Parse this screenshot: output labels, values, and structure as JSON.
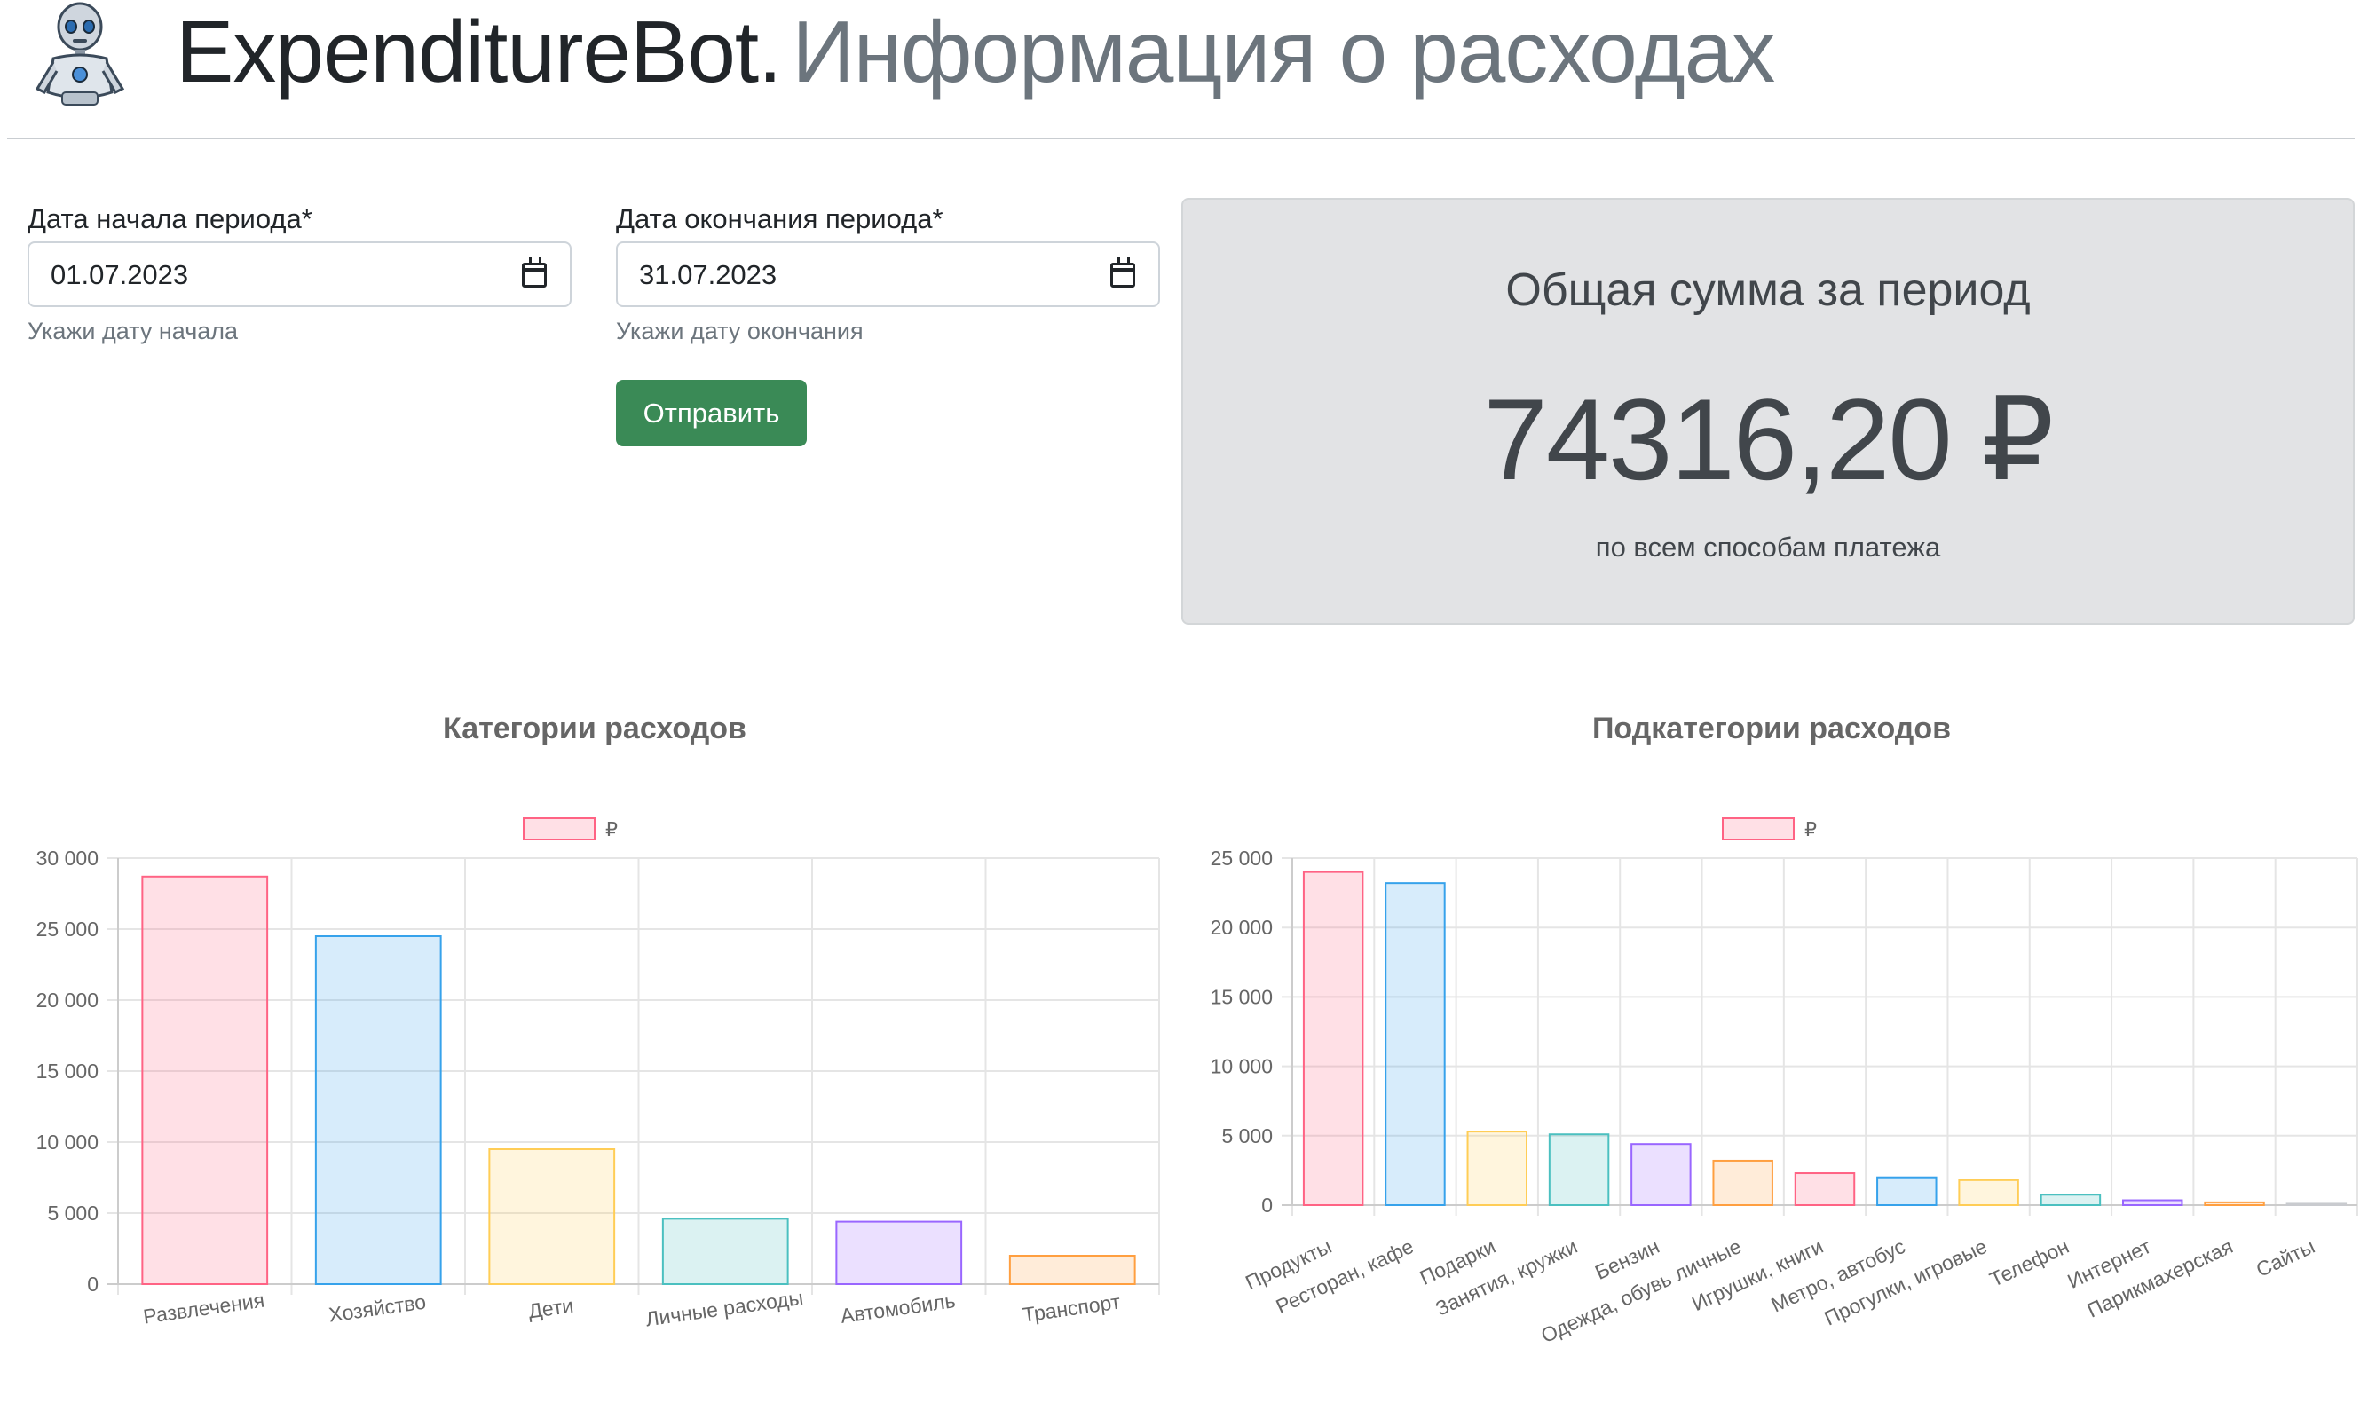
{
  "header": {
    "app_name": "ExpenditureBot.",
    "subtitle": "Информация о расходах",
    "logo_icon": "robot-icon"
  },
  "form": {
    "start": {
      "label": "Дата начала периода*",
      "value": "01.07.2023",
      "help": "Укажи дату начала",
      "icon": "calendar-icon"
    },
    "end": {
      "label": "Дата окончания периода*",
      "value": "31.07.2023",
      "help": "Укажи дату окончания",
      "icon": "calendar-icon"
    },
    "submit_label": "Отправить",
    "submit_color": "#3a8a56"
  },
  "summary": {
    "title": "Общая сумма за период",
    "amount": "74316,20 ₽",
    "note": "по всем способам платежа",
    "background": "#e2e3e5"
  },
  "chart_data": [
    {
      "type": "bar",
      "title": "Категории расходов",
      "legend": [
        "₽"
      ],
      "legend_position": "top",
      "grid": true,
      "ylim": [
        0,
        30000
      ],
      "yticks": [
        "0",
        "5 000",
        "10 000",
        "15 000",
        "20 000",
        "25 000",
        "30 000"
      ],
      "categories": [
        "Развлечения",
        "Хозяйство",
        "Дети",
        "Личные расходы",
        "Автомобиль",
        "Транспорт"
      ],
      "series": [
        {
          "name": "₽",
          "values": [
            28700,
            24500,
            9500,
            4600,
            4400,
            2000
          ]
        }
      ],
      "colors": [
        "#ff6384",
        "#36a2eb",
        "#ffcd56",
        "#4bc0c0",
        "#9966ff",
        "#ff9f40"
      ]
    },
    {
      "type": "bar",
      "title": "Подкатегории расходов",
      "legend": [
        "₽"
      ],
      "legend_position": "top",
      "grid": true,
      "ylim": [
        0,
        25000
      ],
      "yticks": [
        "0",
        "5 000",
        "10 000",
        "15 000",
        "20 000",
        "25 000"
      ],
      "categories": [
        "Продукты",
        "Ресторан, кафе",
        "Подарки",
        "Занятия, кружки",
        "Бензин",
        "Одежда, обувь личные",
        "Игрушки, книги",
        "Метро, автобус",
        "Прогулки, игровые",
        "Телефон",
        "Интернет",
        "Парикмахерская",
        "Сайты"
      ],
      "series": [
        {
          "name": "₽",
          "values": [
            24000,
            23200,
            5300,
            5100,
            4400,
            3200,
            2300,
            2000,
            1800,
            750,
            350,
            200,
            100
          ]
        }
      ],
      "colors": [
        "#ff6384",
        "#36a2eb",
        "#ffcd56",
        "#4bc0c0",
        "#9966ff",
        "#ff9f40",
        "#ff6384",
        "#36a2eb",
        "#ffcd56",
        "#4bc0c0",
        "#9966ff",
        "#ff9f40",
        "#c9cbcf"
      ]
    }
  ]
}
